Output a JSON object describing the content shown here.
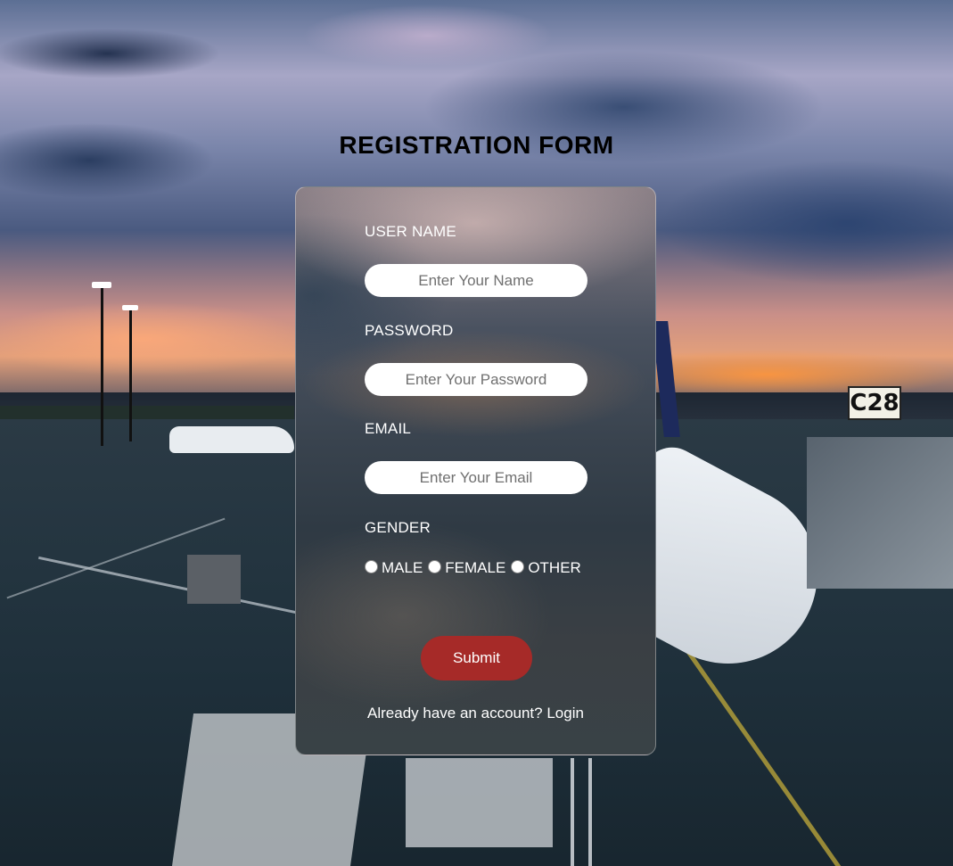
{
  "page": {
    "title": "REGISTRATION FORM"
  },
  "background": {
    "gate_sign": "C28"
  },
  "form": {
    "username": {
      "label": "USER NAME",
      "placeholder": "Enter Your Name",
      "value": ""
    },
    "password": {
      "label": "PASSWORD",
      "placeholder": "Enter Your Password",
      "value": ""
    },
    "email": {
      "label": "EMAIL",
      "placeholder": "Enter Your Email",
      "value": ""
    },
    "gender": {
      "label": "GENDER",
      "options": [
        "MALE",
        "FEMALE",
        "OTHER"
      ],
      "selected": null
    },
    "submit_label": "Submit",
    "login_prompt": "Already have an account?",
    "login_link": "Login"
  },
  "colors": {
    "submit_button": "#a62a28",
    "input_background": "#ffffff",
    "label_text": "#ffffff"
  }
}
